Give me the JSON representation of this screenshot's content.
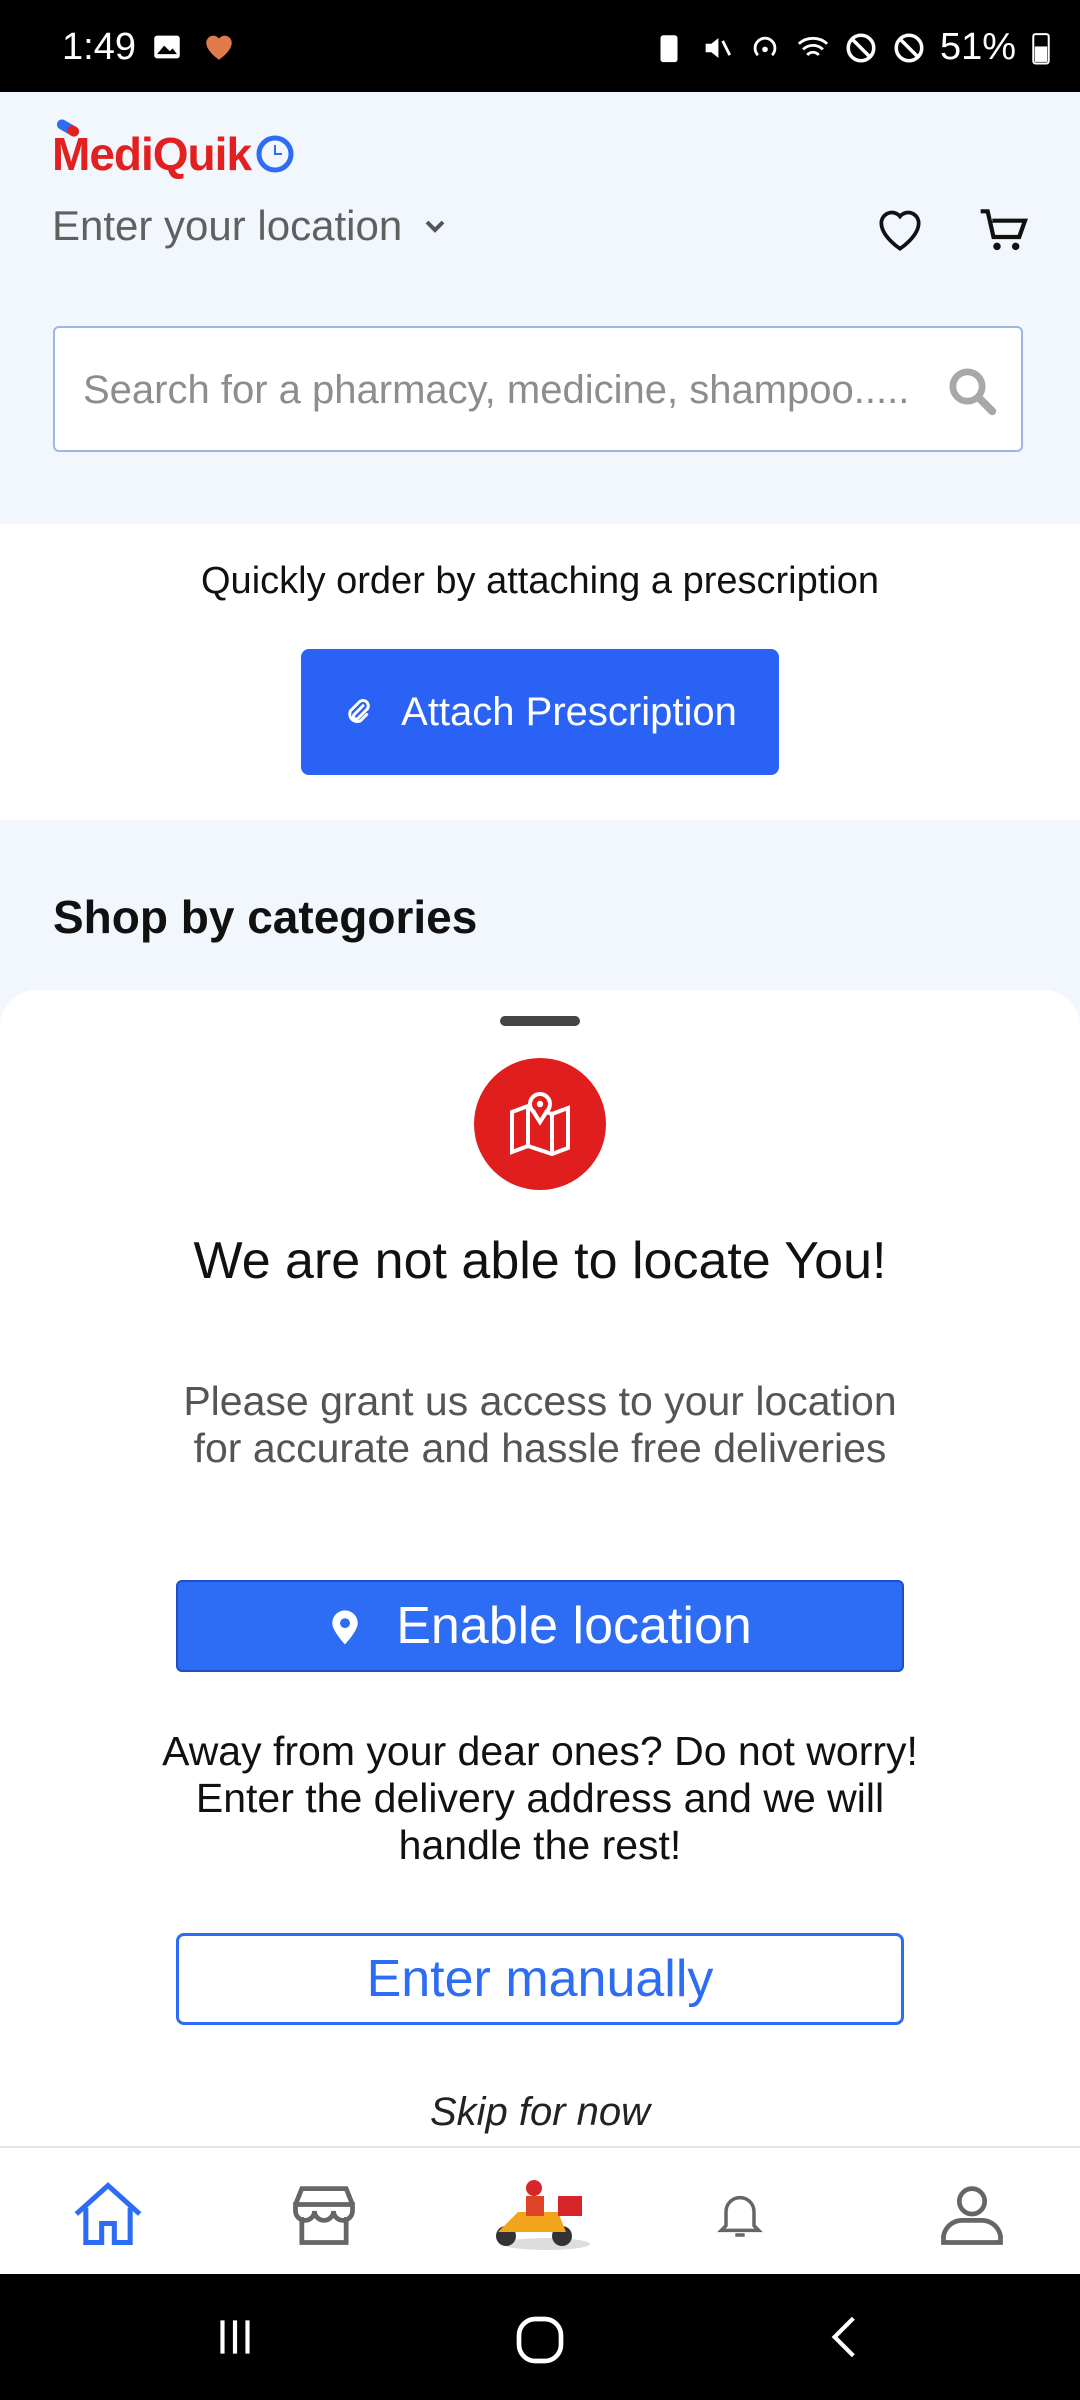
{
  "status_bar": {
    "time": "1:49",
    "battery": "51%"
  },
  "header": {
    "logo_text": "MediQuik",
    "location_placeholder": "Enter your location",
    "search_placeholder": "Search for a pharmacy, medicine, shampoo....."
  },
  "prescription": {
    "prompt": "Quickly order by attaching a prescription",
    "button_label": "Attach Prescription"
  },
  "categories": {
    "heading": "Shop by categories"
  },
  "location_sheet": {
    "title": "We are not able to locate You!",
    "subtitle": "Please grant us access to your location for accurate and hassle free deliveries",
    "enable_button": "Enable location",
    "away_text": "Away from your dear ones? Do not worry! Enter the delivery address and we will handle the rest!",
    "manual_button": "Enter manually",
    "skip_link": "Skip for now"
  },
  "bottom_nav": {
    "items": [
      "home-icon",
      "store-icon",
      "delivery-scooter-icon",
      "bell-icon",
      "profile-icon"
    ]
  },
  "colors": {
    "primary_blue": "#2962f4",
    "brand_red": "#e1201f",
    "header_bg": "#f2f6fd"
  }
}
